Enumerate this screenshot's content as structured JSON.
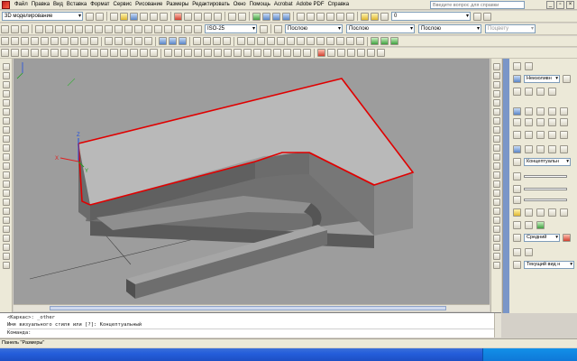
{
  "menu": {
    "items": [
      "Файл",
      "Правка",
      "Вид",
      "Вставка",
      "Формат",
      "Сервис",
      "Рисование",
      "Размеры",
      "Редактировать",
      "Окно",
      "Помощь",
      "Acrobat",
      "Adobe PDF",
      "Справка"
    ],
    "search_placeholder": "Введите вопрос для справки"
  },
  "toolbar1": {
    "workspace": "3D моделирование",
    "layer": "0"
  },
  "toolbar2": {
    "dimstyle": "ISO-25",
    "color": "Послою",
    "linetype": "Послою",
    "lineweight": "Послою",
    "plotstyle": "Поцвету"
  },
  "viewcube": {
    "axis_x": "X",
    "axis_y": "Y",
    "axis_z": "Z"
  },
  "palette": {
    "visual_style": "Неизоливн",
    "render_style": "Концептуальн",
    "quality": "Средний",
    "view": "Текущий вид н"
  },
  "command": {
    "line1": "<Каркас>: _other",
    "line2": "Имя визуального стиля или [?]: Концептуальный",
    "prompt": "Команда:"
  },
  "status": {
    "text": "Панель \"Размеры\""
  }
}
